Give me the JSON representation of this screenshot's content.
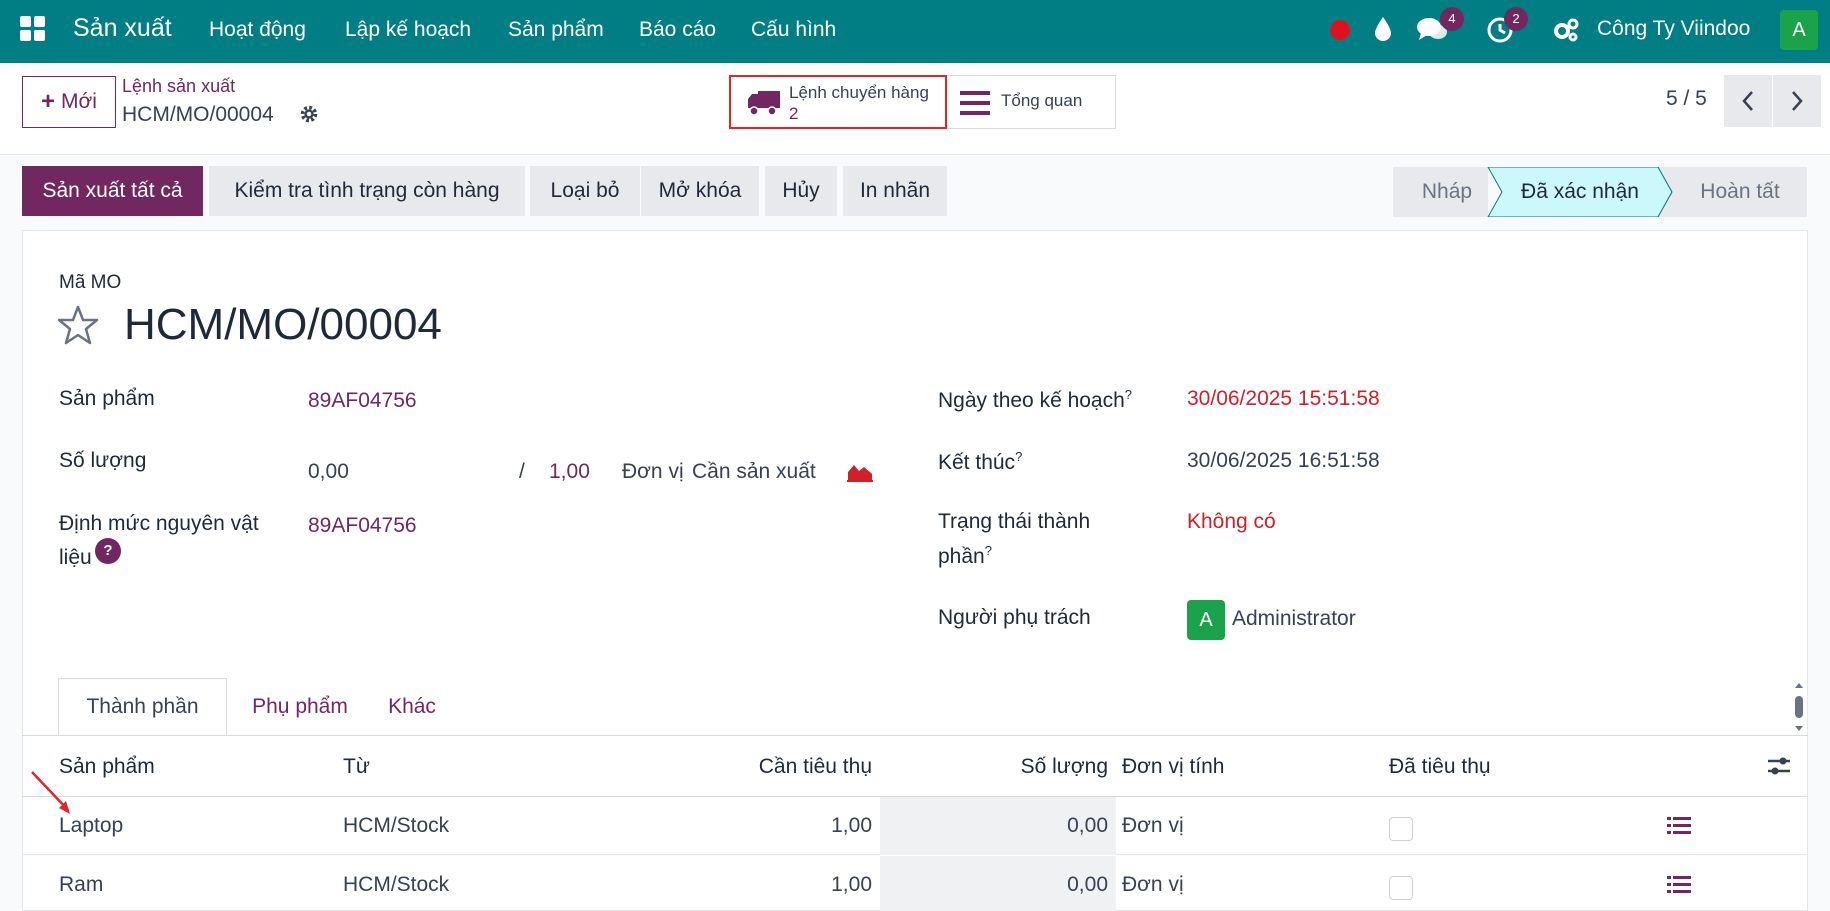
{
  "topbar": {
    "app_name": "Sản xuất",
    "menu": [
      "Hoạt động",
      "Lập kế hoạch",
      "Sản phẩm",
      "Báo cáo",
      "Cấu hình"
    ],
    "messages_count": "4",
    "activities_count": "2",
    "company": "Công Ty Viindoo",
    "user_initial": "A",
    "accent": "#017e84"
  },
  "control": {
    "new_label": "Mới",
    "breadcrumb_parent": "Lệnh sản xuất",
    "breadcrumb_current": "HCM/MO/00004",
    "smart_transfer_label": "Lệnh chuyển hàng",
    "smart_transfer_count": "2",
    "smart_overview_label": "Tổng quan",
    "pager": "5 / 5"
  },
  "actions": [
    "Sản xuất tất cả",
    "Kiểm tra tình trạng còn hàng",
    "Loại bỏ",
    "Mở khóa",
    "Hủy",
    "In nhãn"
  ],
  "stages": [
    "Nháp",
    "Đã xác nhận",
    "Hoàn tất"
  ],
  "form": {
    "mo_label": "Mã MO",
    "mo_name": "HCM/MO/00004",
    "product_label": "Sản phẩm",
    "product_value": "89AF04756",
    "qty_label": "Số lượng",
    "qty_done": "0,00",
    "qty_slash": "/",
    "qty_total": "1,00",
    "qty_uom": "Đơn vị",
    "qty_to_produce": "Cần sản xuất",
    "bom_label_1": "Định mức nguyên vật",
    "bom_label_2": "liệu",
    "bom_help": "?",
    "bom_value": "89AF04756",
    "planned_label": "Ngày theo kế hoạch",
    "planned_value": "30/06/2025 15:51:58",
    "end_label": "Kết thúc",
    "end_value": "30/06/2025 16:51:58",
    "component_status_label_1": "Trạng thái thành",
    "component_status_label_2": "phần",
    "component_status_value": "Không có",
    "responsible_label": "Người phụ trách",
    "responsible_initial": "A",
    "responsible_value": "Administrator",
    "tooltip_mark": "?"
  },
  "tabs": [
    "Thành phần",
    "Phụ phẩm",
    "Khác"
  ],
  "table": {
    "headers": [
      "Sản phẩm",
      "Từ",
      "Cần tiêu thụ",
      "Số lượng",
      "Đơn vị tính",
      "Đã tiêu thụ"
    ],
    "rows": [
      {
        "product": "Laptop",
        "from": "HCM/Stock",
        "to_consume": "1,00",
        "quantity": "0,00",
        "uom": "Đơn vị"
      },
      {
        "product": "Ram",
        "from": "HCM/Stock",
        "to_consume": "1,00",
        "quantity": "0,00",
        "uom": "Đơn vị"
      }
    ]
  }
}
